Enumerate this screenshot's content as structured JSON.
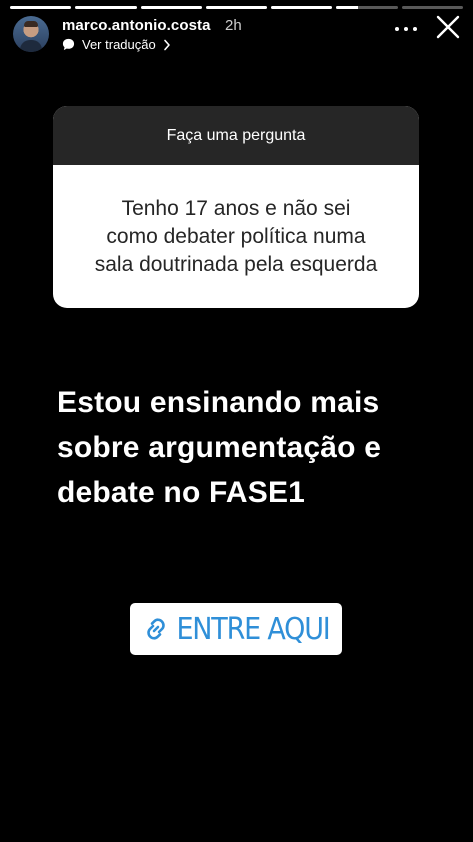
{
  "story": {
    "progress": [
      1,
      1,
      1,
      1,
      1,
      0.35,
      0
    ],
    "username": "marco.antonio.costa",
    "time": "2h",
    "translate_label": "Ver tradução",
    "icons": {
      "avatar": "profile-photo",
      "translate": "speech-bubble-icon",
      "chevron": "chevron-right-icon",
      "more": "more-horizontal-icon",
      "close": "close-icon",
      "link": "link-icon"
    }
  },
  "question": {
    "header": "Faça uma pergunta",
    "lines": [
      "Tenho 17 anos e não sei",
      "como debater política numa",
      "sala doutrinada pela esquerda"
    ]
  },
  "main_text": {
    "lines": [
      "Estou ensinando mais",
      "sobre argumentação e",
      "debate no FASE1"
    ]
  },
  "link": {
    "label": "ENTRE AQUI",
    "color": "#2f8fd8"
  },
  "colors": {
    "background": "#000000",
    "question_header_bg": "#262626",
    "question_body_bg": "#ffffff"
  }
}
